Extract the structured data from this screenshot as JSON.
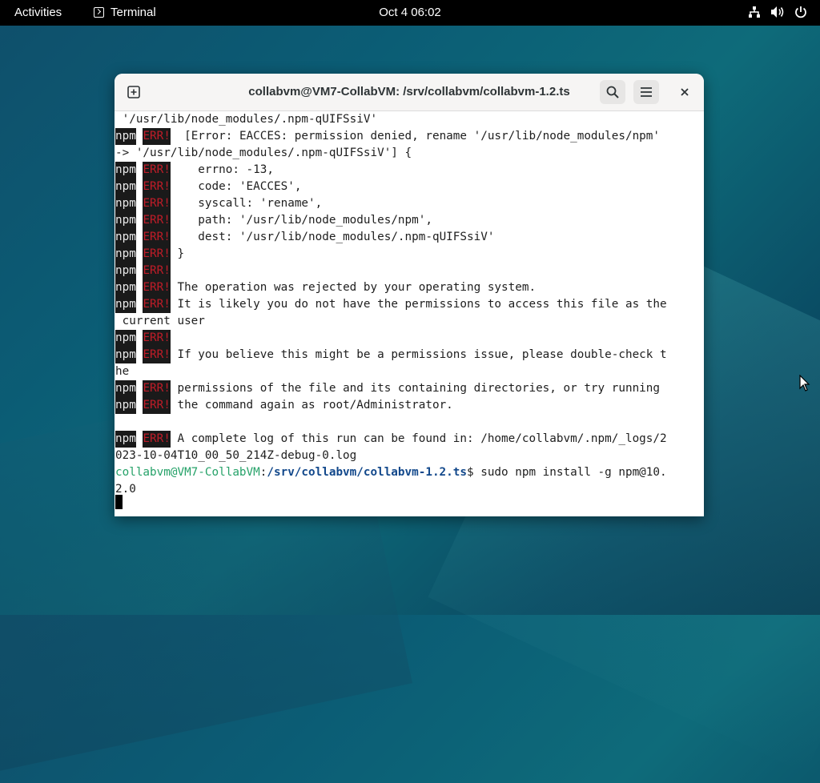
{
  "topbar": {
    "activities": "Activities",
    "app_name": "Terminal",
    "clock": "Oct 4  06:02",
    "icons": [
      "network-icon",
      "volume-icon",
      "power-icon"
    ]
  },
  "window": {
    "title": "collabvm@VM7-CollabVM: /srv/collabvm/collabvm-1.2.ts",
    "buttons": [
      "new-tab-icon",
      "search-icon",
      "menu-icon",
      "close-icon"
    ]
  },
  "terminal": {
    "badge_npm": "npm",
    "badge_err": "ERR!",
    "lines": [
      " '/usr/lib/node_modules/.npm-qUIFSsiV'",
      " [Error: EACCES: permission denied, rename '/usr/lib/node_modules/npm'",
      "-> '/usr/lib/node_modules/.npm-qUIFSsiV'] {",
      "  errno: -13,",
      "  code: 'EACCES',",
      "  syscall: 'rename',",
      "  path: '/usr/lib/node_modules/npm',",
      "  dest: '/usr/lib/node_modules/.npm-qUIFSsiV'",
      "}",
      "",
      "The operation was rejected by your operating system.",
      "It is likely you do not have the permissions to access this file as the",
      " current user",
      "",
      "If you believe this might be a permissions issue, please double-check t",
      "he",
      "permissions of the file and its containing directories, or try running",
      "the command again as root/Administrator.",
      "",
      "A complete log of this run can be found in: /home/collabvm/.npm/_logs/2",
      "023-10-04T10_00_50_214Z-debug-0.log"
    ],
    "prompt_user": "collabvm@VM7-CollabVM",
    "prompt_sep": ":",
    "prompt_path": "/srv/collabvm/collabvm-1.2.ts",
    "prompt_cmd": "$ sudo npm install -g npm@10.",
    "prompt_cmd_wrap": "2.0"
  }
}
